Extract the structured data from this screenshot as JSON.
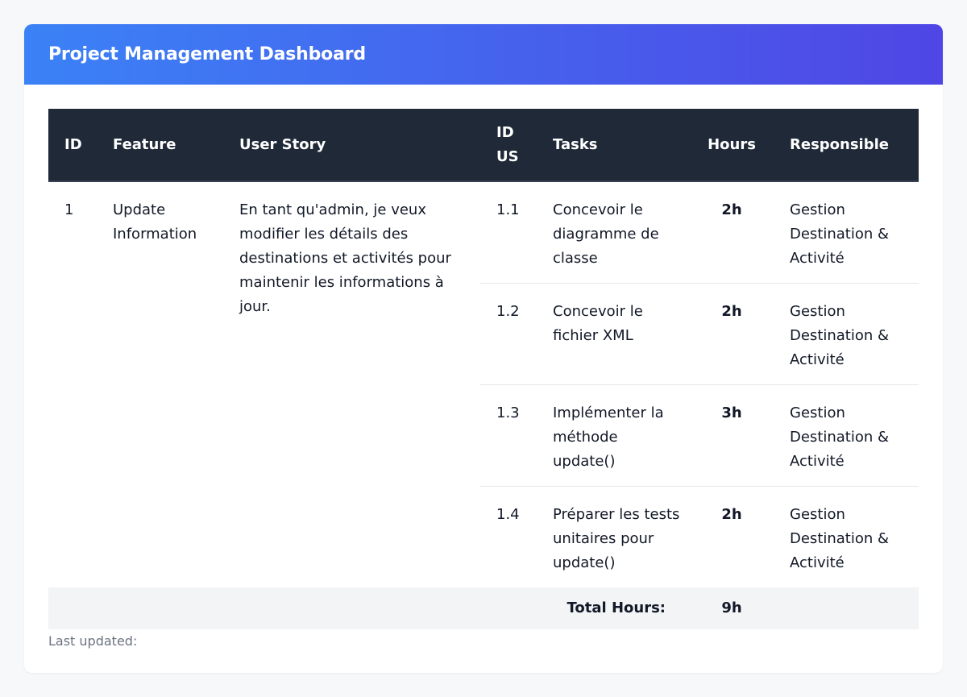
{
  "header": {
    "title": "Project Management Dashboard"
  },
  "table": {
    "columns": {
      "id": "ID",
      "feature": "Feature",
      "user_story": "User Story",
      "id_us": "ID US",
      "tasks": "Tasks",
      "hours": "Hours",
      "responsible": "Responsible"
    },
    "story": {
      "id": "1",
      "feature": "Update Information",
      "user_story": "En tant qu'admin, je veux modifier les détails des destinations et activités pour maintenir les informations à jour."
    },
    "rows": [
      {
        "id_us": "1.1",
        "task": "Concevoir le diagramme de classe",
        "hours": "2h",
        "responsible": "Gestion Destination & Activité"
      },
      {
        "id_us": "1.2",
        "task": "Concevoir le fichier XML",
        "hours": "2h",
        "responsible": "Gestion Destination & Activité"
      },
      {
        "id_us": "1.3",
        "task": "Implémenter la méthode update()",
        "hours": "3h",
        "responsible": "Gestion Destination & Activité"
      },
      {
        "id_us": "1.4",
        "task": "Préparer les tests unitaires pour update()",
        "hours": "2h",
        "responsible": "Gestion Destination & Activité"
      }
    ],
    "total": {
      "label": "Total Hours:",
      "value": "9h"
    }
  },
  "footer": {
    "last_updated_label": "Last updated:"
  },
  "colors": {
    "header_gradient_start": "#3b82f6",
    "header_gradient_end": "#4f46e5",
    "table_header_bg": "#1f2937",
    "total_row_bg": "#f3f4f6"
  }
}
